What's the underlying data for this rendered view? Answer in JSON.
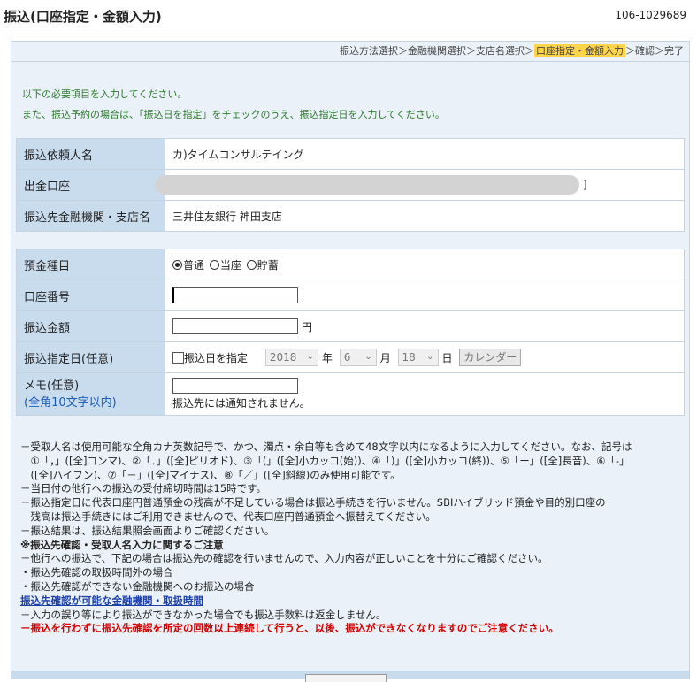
{
  "header": {
    "title": "振込(口座指定・金額入力)",
    "page_id": "106-1029689"
  },
  "steps": {
    "before": "振込方法選択＞金融機関選択＞支店名選択＞",
    "current": "口座指定・金額入力",
    "after": "＞確認＞完了"
  },
  "messages": [
    "以下の必要項目を入力してください。",
    "また、振込予約の場合は、「振込日を指定」をチェックのうえ、振込指定日を入力してください。"
  ],
  "info": {
    "requester_label": "振込依頼人名",
    "requester_value": "カ)タイムコンサルテイング",
    "account_label": "出金口座",
    "account_bracket": "]",
    "bank_label": "振込先金融機関・支店名",
    "bank_value": "三井住友銀行 神田支店"
  },
  "form": {
    "deposit_type_label": "預金種目",
    "deposit_options": [
      "普通",
      "当座",
      "貯蓄"
    ],
    "deposit_selected": "普通",
    "account_no_label": "口座番号",
    "account_no_value": "",
    "amount_label": "振込金額",
    "amount_value": "",
    "amount_unit": "円",
    "date_label": "振込指定日(任意)",
    "date_checkbox_label": "振込日を指定",
    "year": "2018",
    "year_unit": "年",
    "month": "6",
    "month_unit": "月",
    "day": "18",
    "day_unit": "日",
    "calendar_button": "カレンダー",
    "memo_label": "メモ(任意)",
    "memo_sublabel": "(全角10文字以内)",
    "memo_value": "",
    "memo_note": "振込先には通知されません。"
  },
  "notes": [
    "－受取人名は使用可能な全角カナ英数記号で、かつ、濁点・余白等も含めて48文字以内になるように入力してください。なお、記号は",
    "　①「，」([全]コンマ)、②「．」([全]ピリオド)、③「(」([全]小カッコ(始))、④「)」([全]小カッコ(終))、⑤「ー」([全]長音)、⑥「-」",
    "　([全]ハイフン)、⑦「－」([全]マイナス)、⑧「／」([全]斜線)のみ使用可能です。",
    "－当日付の他行への振込の受付締切時間は15時です。",
    "－振込指定日に代表口座円普通預金の残高が不足している場合は振込手続きを行いません。SBIハイブリッド預金や目的別口座の",
    "　残高は振込手続きにはご利用できませんので、代表口座円普通預金へ振替えてください。",
    "－振込結果は、振込結果照会画面よりご確認ください。"
  ],
  "caution": {
    "heading": "※振込先確認・受取人名入力に関するご注意",
    "lines": [
      "－他行への振込で、下記の場合は振込先の確認を行いませんので、入力内容が正しいことを十分にご確認ください。",
      "・振込先確認の取扱時間外の場合",
      "・振込先確認ができない金融機関へのお振込の場合"
    ],
    "link": "振込先確認が可能な金融機関・取扱時間",
    "after_link": "－入力の誤り等により振込ができなかった場合でも振込手数料は返金しません。",
    "warning": "－振込を行わずに振込先確認を所定の回数以上連続して行うと、以後、振込ができなくなりますのでご注意ください。"
  }
}
